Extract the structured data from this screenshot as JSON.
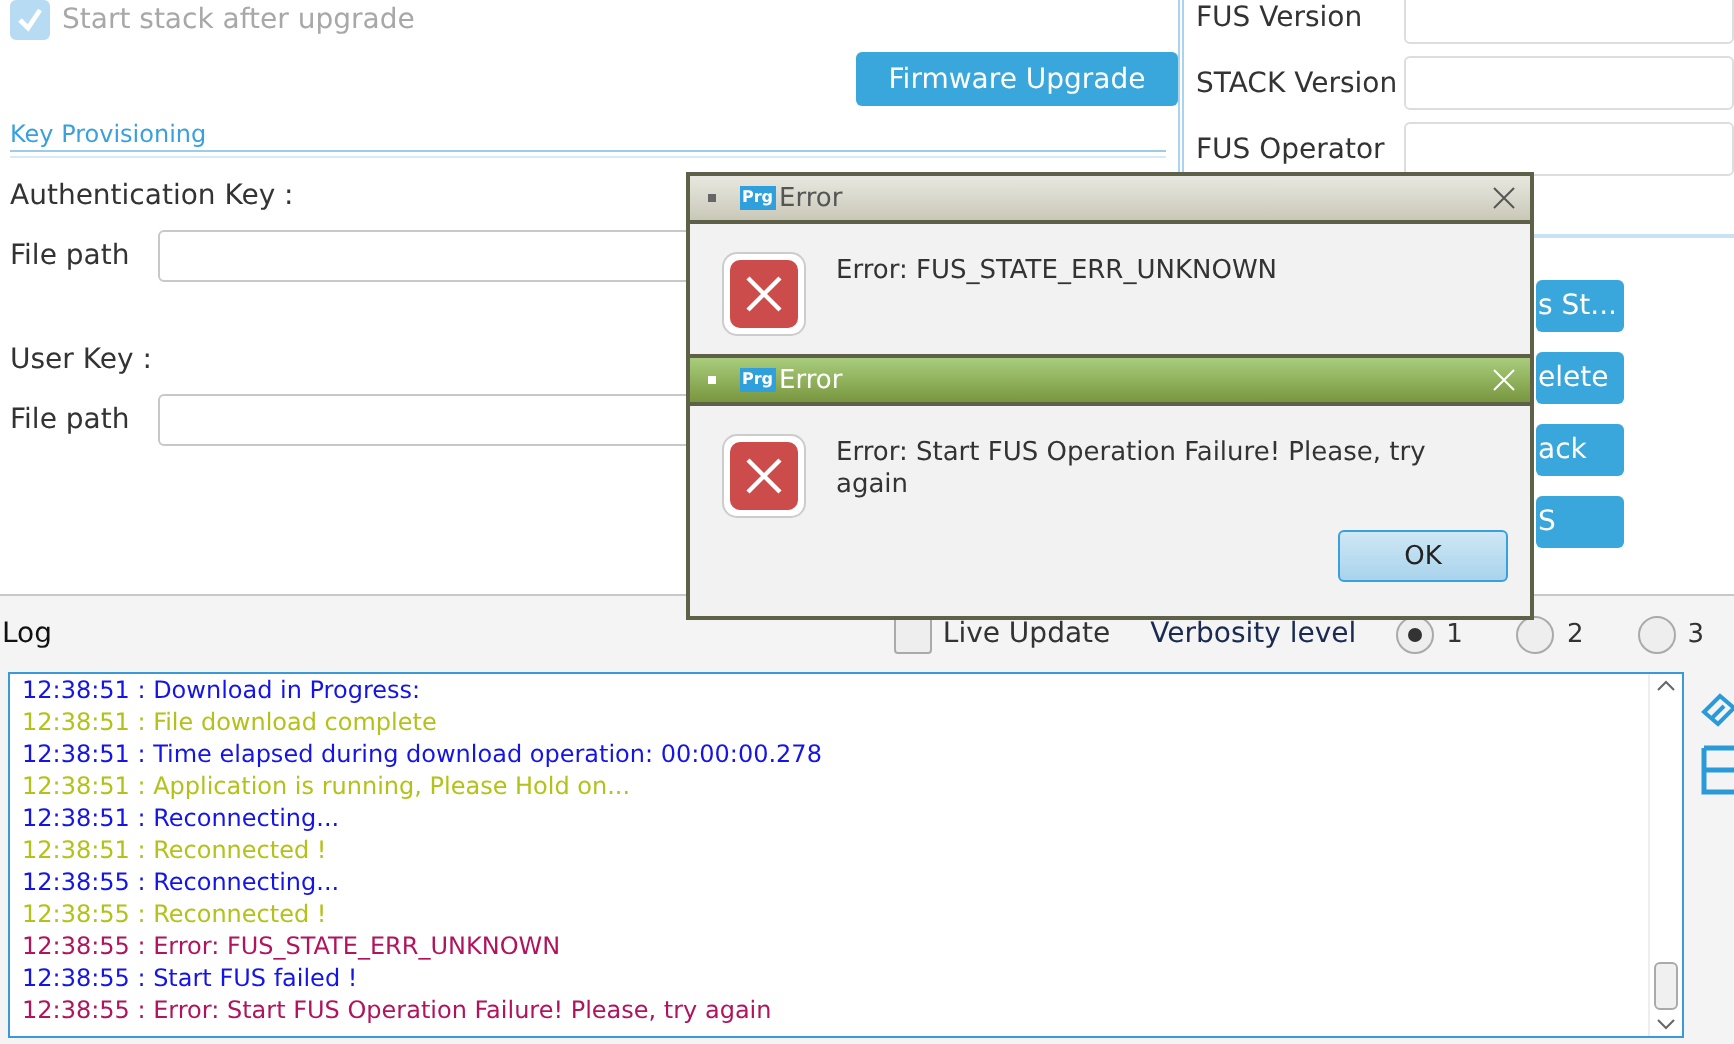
{
  "upgrade": {
    "start_stack": {
      "label": "Start stack after upgrade",
      "checked": true,
      "disabled": true
    },
    "button": "Firmware Upgrade"
  },
  "key_provisioning": {
    "title": "Key Provisioning",
    "sections": [
      {
        "label": "Authentication Key :",
        "field_label": "File path"
      },
      {
        "label": "User Key :",
        "field_label": "File path"
      }
    ]
  },
  "info_fields": [
    {
      "label": "FUS Version"
    },
    {
      "label": "STACK Version"
    },
    {
      "label": "FUS Operator"
    }
  ],
  "action_buttons": [
    "s St...",
    "elete",
    "ack",
    "S"
  ],
  "log": {
    "title": "Log",
    "live_update": {
      "label": "Live Update",
      "checked": false
    },
    "verbosity": {
      "label": "Verbosity level",
      "options": [
        {
          "label": "1",
          "selected": true
        },
        {
          "label": "2",
          "selected": false
        },
        {
          "label": "3",
          "selected": false
        }
      ]
    },
    "lines": [
      {
        "text": "12:38:51 : Download in Progress:",
        "kind": "info"
      },
      {
        "text": "12:38:51 : File download complete",
        "kind": "success"
      },
      {
        "text": "12:38:51 : Time elapsed during download operation: 00:00:00.278",
        "kind": "info"
      },
      {
        "text": "12:38:51 : Application is running, Please Hold on...",
        "kind": "success"
      },
      {
        "text": "12:38:51 : Reconnecting...",
        "kind": "info"
      },
      {
        "text": "12:38:51 : Reconnected !",
        "kind": "success"
      },
      {
        "text": "12:38:55 : Reconnecting...",
        "kind": "info"
      },
      {
        "text": "12:38:55 : Reconnected !",
        "kind": "success"
      },
      {
        "text": "12:38:55 : Error: FUS_STATE_ERR_UNKNOWN",
        "kind": "error"
      },
      {
        "text": "12:38:55 : Start FUS failed !",
        "kind": "info"
      },
      {
        "text": "12:38:55 : Error: Start FUS Operation Failure! Please, try again",
        "kind": "error"
      }
    ]
  },
  "dialogs": [
    {
      "title": "Error",
      "badge": "Prg",
      "active": false,
      "message": "Error: FUS_STATE_ERR_UNKNOWN"
    },
    {
      "title": "Error",
      "badge": "Prg",
      "active": true,
      "message": "Error: Start FUS Operation Failure! Please, try again",
      "button": "OK"
    }
  ]
}
